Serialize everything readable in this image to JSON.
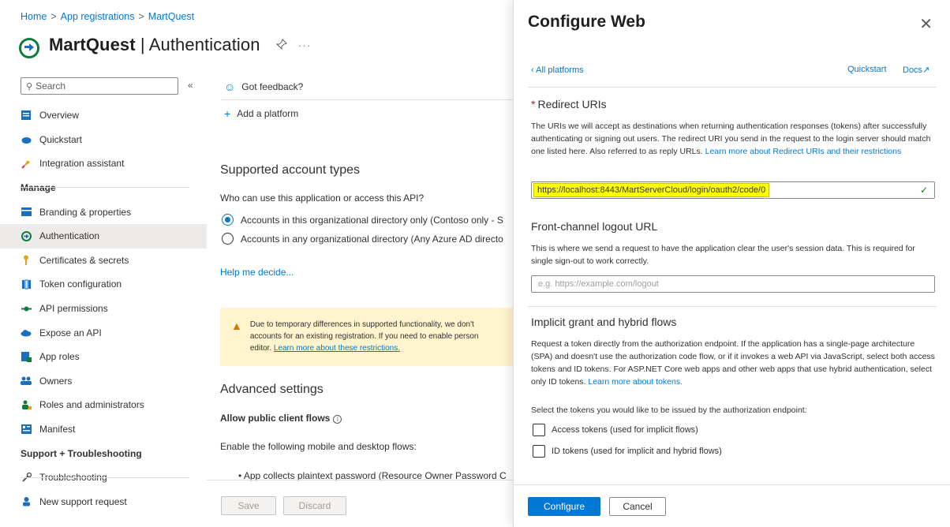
{
  "breadcrumb": {
    "items": [
      "Home",
      "App registrations",
      "MartQuest"
    ],
    "sep": ">"
  },
  "header": {
    "app_name": "MartQuest",
    "separator": " | ",
    "page": "Authentication",
    "pin": "📌",
    "more": "···"
  },
  "sidebar": {
    "search_placeholder": "Search",
    "collapse": "«",
    "items_top": [
      {
        "label": "Overview",
        "icon": "overview-icon"
      },
      {
        "label": "Quickstart",
        "icon": "quickstart-icon"
      },
      {
        "label": "Integration assistant",
        "icon": "rocket-icon"
      }
    ],
    "section_manage": "Manage",
    "items_manage": [
      {
        "label": "Branding & properties",
        "icon": "branding-icon"
      },
      {
        "label": "Authentication",
        "icon": "authentication-icon"
      },
      {
        "label": "Certificates & secrets",
        "icon": "key-icon"
      },
      {
        "label": "Token configuration",
        "icon": "token-icon"
      },
      {
        "label": "API permissions",
        "icon": "api-permissions-icon"
      },
      {
        "label": "Expose an API",
        "icon": "cloud-icon"
      },
      {
        "label": "App roles",
        "icon": "app-roles-icon"
      },
      {
        "label": "Owners",
        "icon": "owners-icon"
      },
      {
        "label": "Roles and administrators",
        "icon": "roles-icon"
      },
      {
        "label": "Manifest",
        "icon": "manifest-icon"
      }
    ],
    "section_support": "Support + Troubleshooting",
    "items_support": [
      {
        "label": "Troubleshooting",
        "icon": "wrench-icon"
      },
      {
        "label": "New support request",
        "icon": "support-icon"
      }
    ]
  },
  "main": {
    "feedback": "Got feedback?",
    "add_platform": "Add a platform",
    "supported_title": "Supported account types",
    "question": "Who can use this application or access this API?",
    "radio1": "Accounts in this organizational directory only (Contoso only - S",
    "radio2": "Accounts in any organizational directory (Any Azure AD directo",
    "help": "Help me decide...",
    "warning_line1": "Due to temporary differences in supported functionality, we don't",
    "warning_line2": "accounts for an existing registration. If you need to enable person",
    "warning_line3_prefix": "editor.",
    "warning_link": "Learn more about these restrictions.",
    "advanced_title": "Advanced settings",
    "allow_public": "Allow public client flows",
    "info": "i",
    "enable_flows": "Enable the following mobile and desktop flows:",
    "bullet": "• App collects plaintext password (Resource Owner Password C",
    "save": "Save",
    "discard": "Discard"
  },
  "panel": {
    "title": "Configure Web",
    "close": "✕",
    "back": "‹ All platforms",
    "quickstart": "Quickstart",
    "docs": "Docs↗",
    "redirect_heading": "Redirect URIs",
    "required_mark": "*",
    "redirect_desc": "The URIs we will accept as destinations when returning authentication responses (tokens) after successfully authenticating or signing out users. The redirect URI you send in the request to the login server should match one listed here. Also referred to as reply URLs.",
    "redirect_link": "Learn more about Redirect URIs and their restrictions",
    "redirect_value": "https://localhost:8443/MartServerCloud/login/oauth2/code/0",
    "check": "✓",
    "logout_heading": "Front-channel logout URL",
    "logout_desc": "This is where we send a request to have the application clear the user's session data. This is required for single sign-out to work correctly.",
    "logout_placeholder": "e.g. https://example.com/logout",
    "implicit_heading": "Implicit grant and hybrid flows",
    "implicit_desc": "Request a token directly from the authorization endpoint. If the application has a single-page architecture (SPA) and doesn't use the authorization code flow, or if it invokes a web API via JavaScript, select both access tokens and ID tokens. For ASP.NET Core web apps and other web apps that use hybrid authentication, select only ID tokens.",
    "implicit_link": "Learn more about tokens.",
    "select_tokens": "Select the tokens you would like to be issued by the authorization endpoint:",
    "access_tokens": "Access tokens (used for implicit flows)",
    "id_tokens": "ID tokens (used for implicit and hybrid flows)",
    "configure": "Configure",
    "cancel": "Cancel"
  }
}
